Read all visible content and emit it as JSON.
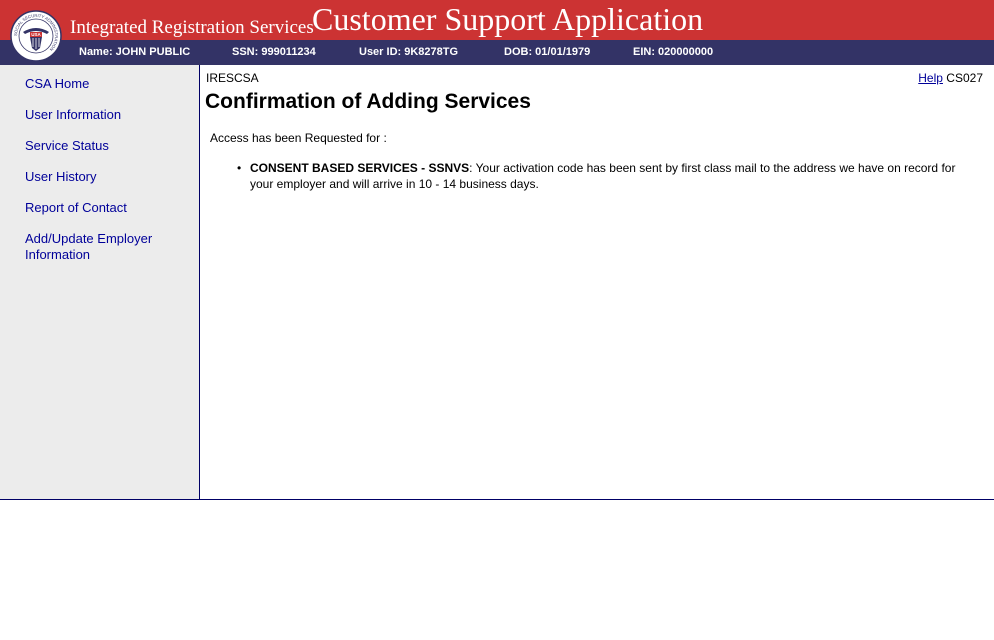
{
  "header": {
    "system_name": "Integrated Registration Services",
    "app_title": "Customer Support Application",
    "seal_text": "SOCIAL SECURITY ADMINISTRATION",
    "seal_usa": "USA",
    "colors": {
      "header_red": "#cc3333",
      "info_bar": "#333366",
      "link": "#000099"
    }
  },
  "info_bar": {
    "name": "Name: JOHN PUBLIC",
    "ssn": "SSN: 999011234",
    "user_id": "User ID: 9K8278TG",
    "dob": "DOB: 01/01/1979",
    "ein": "EIN: 020000000"
  },
  "sidebar": {
    "items": [
      {
        "label": "CSA Home"
      },
      {
        "label": "User Information"
      },
      {
        "label": "Service Status"
      },
      {
        "label": "User History"
      },
      {
        "label": "Report of Contact"
      },
      {
        "label": "Add/Update Employer Information"
      }
    ]
  },
  "main": {
    "screen_id": "IRESCSA",
    "help_label": "Help",
    "screen_code": "CS027",
    "title": "Confirmation of Adding Services",
    "intro": "Access has been Requested for :",
    "services": [
      {
        "name": "CONSENT BASED SERVICES - SSNVS",
        "message": ": Your activation code has been sent by first class mail to the address we have on record for your employer and will arrive in 10 - 14 business days."
      }
    ]
  }
}
